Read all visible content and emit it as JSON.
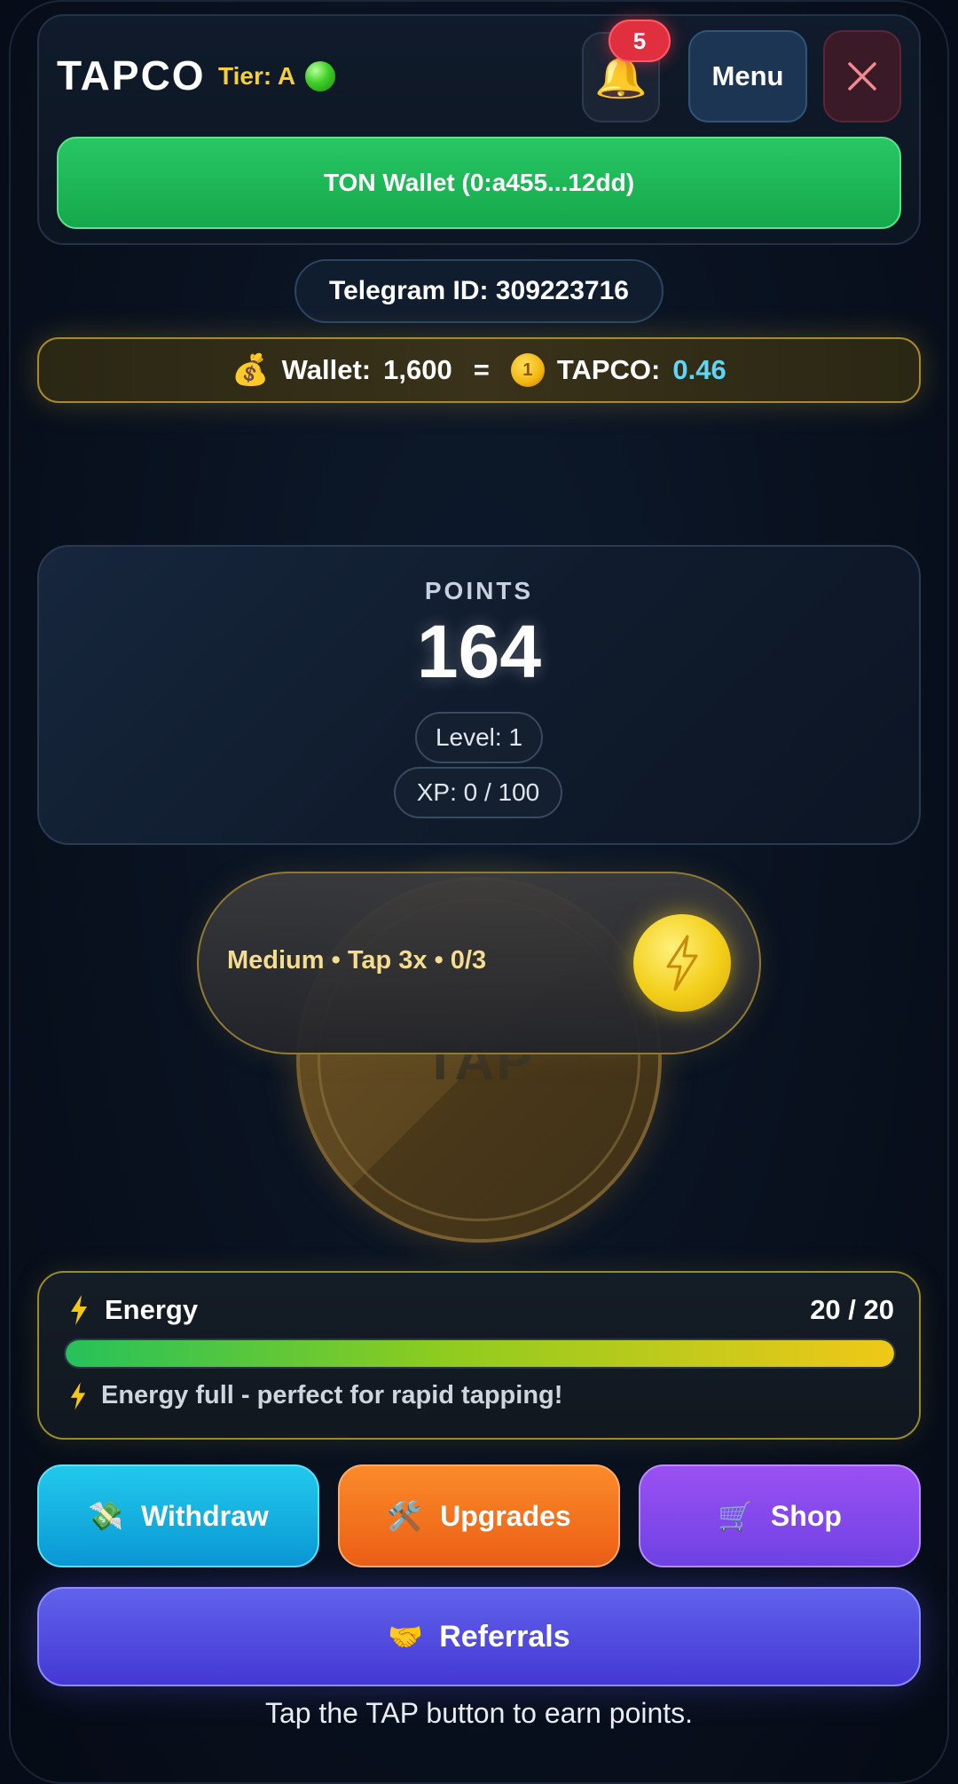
{
  "header": {
    "brand": "TAPCO",
    "tier_label": "Tier: A",
    "notification_count": "5",
    "menu_label": "Menu",
    "wallet_button_label": "TON Wallet (0:a455...12dd)"
  },
  "telegram": {
    "id_label": "Telegram ID: 309223716"
  },
  "balance": {
    "wallet_label": "Wallet:",
    "wallet_value": "1,600",
    "equals": "=",
    "tapco_label": "TAPCO:",
    "tapco_value": "0.46",
    "tapco_value_color": "#5fd6f6"
  },
  "points": {
    "label": "POINTS",
    "value": "164",
    "level_label": "Level: 1",
    "xp_label": "XP: 0 / 100"
  },
  "tap": {
    "button_label": "TAP",
    "hint": "Medium • Tap 3x • 0/3"
  },
  "energy": {
    "title": "Energy",
    "count": "20 / 20",
    "fill_fraction": 1.0,
    "message": "Energy full - perfect for rapid tapping!"
  },
  "actions": {
    "withdraw": {
      "label": "Withdraw",
      "icon": "money-with-wings-icon",
      "color": "#0a98d4"
    },
    "upgrades": {
      "label": "Upgrades",
      "icon": "hammer-wrench-icon",
      "color": "#ec5f14"
    },
    "shop": {
      "label": "Shop",
      "icon": "shopping-cart-icon",
      "color": "#6f42e4"
    },
    "referrals": {
      "label": "Referrals",
      "icon": "handshake-icon",
      "color": "#4438d4"
    }
  },
  "footer": {
    "hint": "Tap the TAP button to earn points."
  },
  "colors": {
    "accent_gold": "#f5cf3b",
    "wallet_green": "#16a84c",
    "badge_red": "#e0303f"
  }
}
